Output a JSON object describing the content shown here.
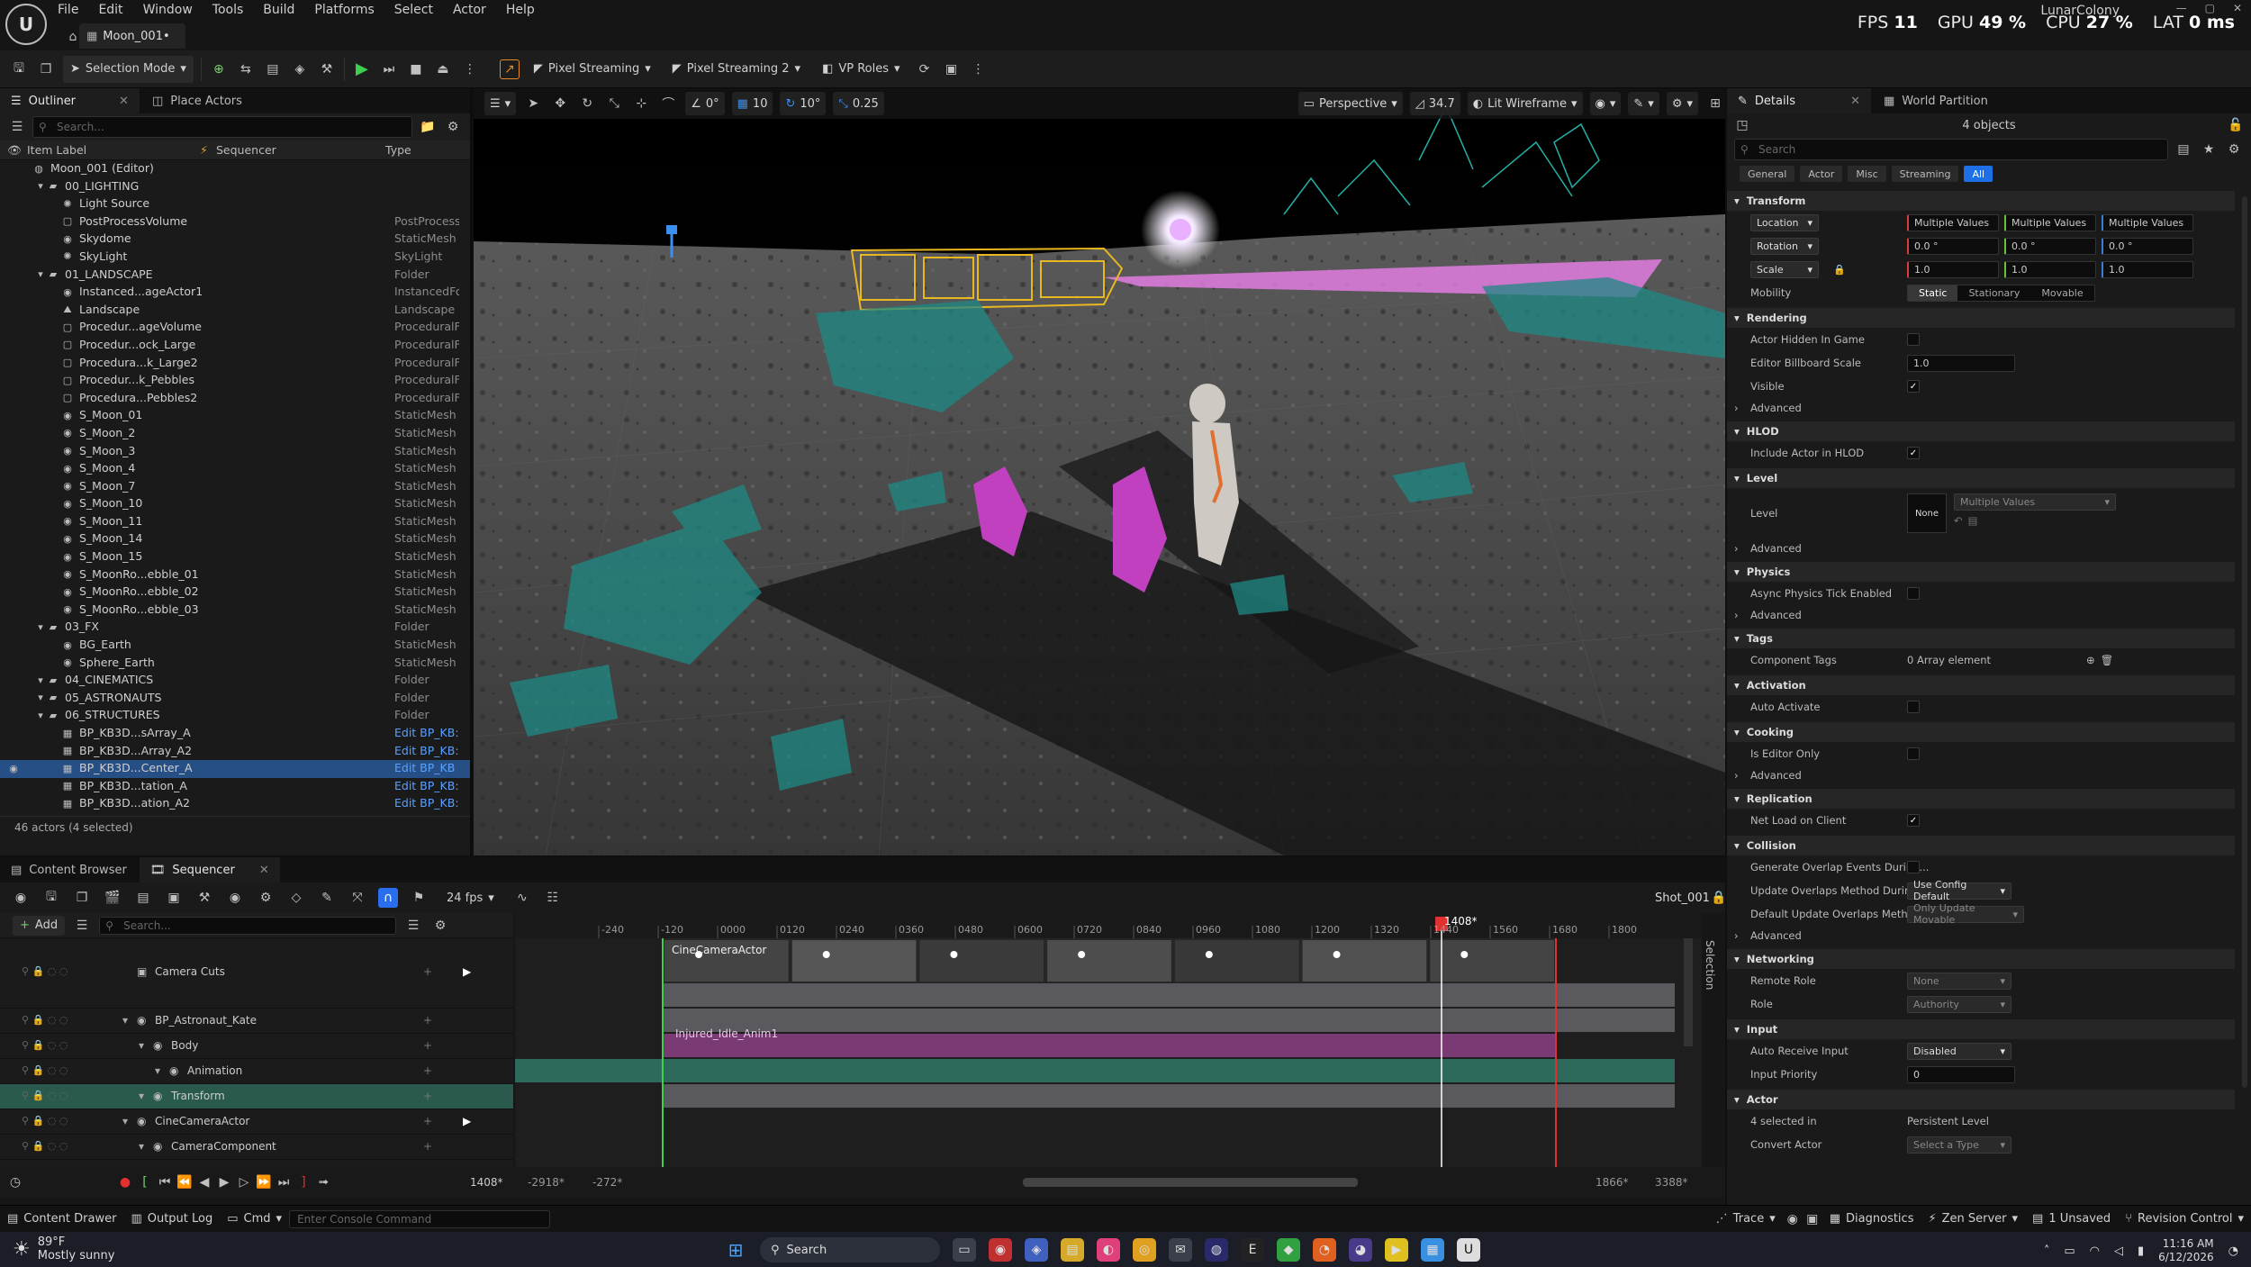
{
  "window": {
    "menu": [
      "File",
      "Edit",
      "Window",
      "Tools",
      "Build",
      "Platforms",
      "Select",
      "Actor",
      "Help"
    ],
    "map_tab": "Moon_001•",
    "project": "LunarColony",
    "stats": {
      "fps_label": "FPS",
      "fps": "11",
      "gpu_label": "GPU",
      "gpu": "49 %",
      "cpu_label": "CPU",
      "cpu": "27 %",
      "lat_label": "LAT",
      "lat": "0 ms"
    }
  },
  "toolbar": {
    "selection_mode": "Selection Mode",
    "pixel_streaming": "Pixel Streaming",
    "pixel_streaming2": "Pixel Streaming 2",
    "vp_roles": "VP Roles"
  },
  "outliner": {
    "tab": "Outliner",
    "tab2": "Place Actors",
    "search_placeholder": "Search...",
    "col_label": "Item Label",
    "col_seq": "Sequencer",
    "col_type": "Type",
    "rows": [
      {
        "label": "Moon_001 (Editor)",
        "type": "",
        "indent": 1,
        "icon": "world"
      },
      {
        "label": "00_LIGHTING",
        "type": "",
        "indent": 2,
        "icon": "folder"
      },
      {
        "label": "Light Source",
        "type": "",
        "indent": 3,
        "icon": "light"
      },
      {
        "label": "PostProcessVolume",
        "type": "PostProcess",
        "indent": 3,
        "icon": "box"
      },
      {
        "label": "Skydome",
        "type": "StaticMesh",
        "indent": 3,
        "icon": "mesh"
      },
      {
        "label": "SkyLight",
        "type": "SkyLight",
        "indent": 3,
        "icon": "light"
      },
      {
        "label": "01_LANDSCAPE",
        "type": "Folder",
        "indent": 2,
        "icon": "folder"
      },
      {
        "label": "Instanced...ageActor1",
        "type": "InstancedFo",
        "indent": 3,
        "icon": "mesh"
      },
      {
        "label": "Landscape",
        "type": "Landscape",
        "indent": 3,
        "icon": "land"
      },
      {
        "label": "Procedur...ageVolume",
        "type": "ProceduralF",
        "indent": 3,
        "icon": "box"
      },
      {
        "label": "Procedur...ock_Large",
        "type": "ProceduralF",
        "indent": 3,
        "icon": "box"
      },
      {
        "label": "Procedura...k_Large2",
        "type": "ProceduralF",
        "indent": 3,
        "icon": "box"
      },
      {
        "label": "Procedur...k_Pebbles",
        "type": "ProceduralF",
        "indent": 3,
        "icon": "box"
      },
      {
        "label": "Procedura...Pebbles2",
        "type": "ProceduralF",
        "indent": 3,
        "icon": "box"
      },
      {
        "label": "S_Moon_01",
        "type": "StaticMesh",
        "indent": 3,
        "icon": "mesh"
      },
      {
        "label": "S_Moon_2",
        "type": "StaticMesh",
        "indent": 3,
        "icon": "mesh"
      },
      {
        "label": "S_Moon_3",
        "type": "StaticMesh",
        "indent": 3,
        "icon": "mesh"
      },
      {
        "label": "S_Moon_4",
        "type": "StaticMesh",
        "indent": 3,
        "icon": "mesh"
      },
      {
        "label": "S_Moon_7",
        "type": "StaticMesh",
        "indent": 3,
        "icon": "mesh"
      },
      {
        "label": "S_Moon_10",
        "type": "StaticMesh",
        "indent": 3,
        "icon": "mesh"
      },
      {
        "label": "S_Moon_11",
        "type": "StaticMesh",
        "indent": 3,
        "icon": "mesh"
      },
      {
        "label": "S_Moon_14",
        "type": "StaticMesh",
        "indent": 3,
        "icon": "mesh"
      },
      {
        "label": "S_Moon_15",
        "type": "StaticMesh",
        "indent": 3,
        "icon": "mesh"
      },
      {
        "label": "S_MoonRo...ebble_01",
        "type": "StaticMesh",
        "indent": 3,
        "icon": "mesh"
      },
      {
        "label": "S_MoonRo...ebble_02",
        "type": "StaticMesh",
        "indent": 3,
        "icon": "mesh"
      },
      {
        "label": "S_MoonRo...ebble_03",
        "type": "StaticMesh",
        "indent": 3,
        "icon": "mesh"
      },
      {
        "label": "03_FX",
        "type": "Folder",
        "indent": 2,
        "icon": "folder"
      },
      {
        "label": "BG_Earth",
        "type": "StaticMesh",
        "indent": 3,
        "icon": "mesh"
      },
      {
        "label": "Sphere_Earth",
        "type": "StaticMesh",
        "indent": 3,
        "icon": "mesh"
      },
      {
        "label": "04_CINEMATICS",
        "type": "Folder",
        "indent": 2,
        "icon": "folder"
      },
      {
        "label": "05_ASTRONAUTS",
        "type": "Folder",
        "indent": 2,
        "icon": "folder"
      },
      {
        "label": "06_STRUCTURES",
        "type": "Folder",
        "indent": 2,
        "icon": "folder"
      },
      {
        "label": "BP_KB3D...sArray_A",
        "type": "Edit BP_KB:",
        "indent": 3,
        "icon": "bp",
        "link": true
      },
      {
        "label": "BP_KB3D...Array_A2",
        "type": "Edit BP_KB:",
        "indent": 3,
        "icon": "bp",
        "link": true
      },
      {
        "label": "BP_KB3D...Center_A",
        "type": "Edit BP_KB",
        "indent": 3,
        "icon": "bp",
        "link": true,
        "sel": true
      },
      {
        "label": "BP_KB3D...tation_A",
        "type": "Edit BP_KB:",
        "indent": 3,
        "icon": "bp",
        "link": true
      },
      {
        "label": "BP_KB3D...ation_A2",
        "type": "Edit BP_KB:",
        "indent": 3,
        "icon": "bp",
        "link": true
      }
    ],
    "footer": "46 actors (4 selected)"
  },
  "viewport": {
    "perspective": "Perspective",
    "fov": "34.7",
    "view_mode": "Lit Wireframe",
    "snap_move": "10",
    "snap_rot": "10°",
    "snap_scale": "0.25",
    "cam_speed": "0°"
  },
  "details": {
    "tab": "Details",
    "tab2": "World Partition",
    "objects": "4 objects",
    "search_placeholder": "Search",
    "filters": [
      "General",
      "Actor",
      "Misc",
      "Streaming",
      "All"
    ],
    "transform": {
      "title": "Transform",
      "location": "Location",
      "rotation": "Rotation",
      "scale": "Scale",
      "multi": "Multiple Values",
      "rot_vals": [
        "0.0 °",
        "0.0 °",
        "0.0 °"
      ],
      "scale_vals": [
        "1.0",
        "1.0",
        "1.0"
      ],
      "mobility": "Mobility",
      "mob_opts": [
        "Static",
        "Stationary",
        "Movable"
      ]
    },
    "rendering": {
      "title": "Rendering",
      "hidden": "Actor Hidden In Game",
      "billboard": "Editor Billboard Scale",
      "billboard_val": "1.0",
      "visible": "Visible",
      "advanced": "Advanced"
    },
    "hlod": {
      "title": "HLOD",
      "include": "Include Actor in HLOD"
    },
    "level": {
      "title": "Level",
      "label": "Level",
      "none": "None",
      "multi": "Multiple Values",
      "advanced": "Advanced"
    },
    "physics": {
      "title": "Physics",
      "async": "Async Physics Tick Enabled",
      "advanced": "Advanced"
    },
    "tags": {
      "title": "Tags",
      "comp": "Component Tags",
      "val": "0 Array element"
    },
    "activation": {
      "title": "Activation",
      "auto": "Auto Activate"
    },
    "cooking": {
      "title": "Cooking",
      "editor_only": "Is Editor Only",
      "advanced": "Advanced"
    },
    "replication": {
      "title": "Replication",
      "net": "Net Load on Client"
    },
    "collision": {
      "title": "Collision",
      "gen": "Generate Overlap Events During...",
      "upd": "Update Overlaps Method During...",
      "upd_val": "Use Config Default",
      "def": "Default Update Overlaps Method...",
      "def_val": "Only Update Movable",
      "advanced": "Advanced"
    },
    "networking": {
      "title": "Networking",
      "remote": "Remote Role",
      "remote_val": "None",
      "role": "Role",
      "role_val": "Authority"
    },
    "input": {
      "title": "Input",
      "auto": "Auto Receive Input",
      "auto_val": "Disabled",
      "prio": "Input Priority",
      "prio_val": "0"
    },
    "actor": {
      "title": "Actor",
      "sel": "4 selected in",
      "sel_val": "Persistent Level",
      "convert": "Convert Actor",
      "convert_val": "Select a Type"
    }
  },
  "sequencer": {
    "tab1": "Content Browser",
    "tab2": "Sequencer",
    "fps": "24 fps",
    "shot": "Shot_001",
    "add": "Add",
    "search_placeholder": "Search...",
    "ruler": [
      "-240",
      "-120",
      "0000",
      "0120",
      "0240",
      "0360",
      "0480",
      "0600",
      "0720",
      "0840",
      "0960",
      "1080",
      "1200",
      "1320",
      "1440",
      "1560",
      "1680",
      "1800"
    ],
    "playhead": "1408*",
    "tracks": [
      {
        "label": "Camera Cuts",
        "indent": 0
      },
      {
        "label": "BP_Astronaut_Kate",
        "indent": 0
      },
      {
        "label": "Body",
        "indent": 1
      },
      {
        "label": "Animation",
        "indent": 2
      },
      {
        "label": "Transform",
        "indent": 1
      },
      {
        "label": "CineCameraActor",
        "indent": 0
      },
      {
        "label": "CameraComponent",
        "indent": 1
      }
    ],
    "cam_clip": "CineCameraActor",
    "anim_clip": "Injured_Idle_Anim1",
    "frame": "1408*",
    "range_start": "-2918*",
    "range_in": "-272*",
    "range_out": "1866*",
    "range_end": "3388*",
    "selection": "Selection"
  },
  "statusbar": {
    "content_drawer": "Content Drawer",
    "output_log": "Output Log",
    "cmd": "Cmd",
    "console_placeholder": "Enter Console Command",
    "trace": "Trace",
    "diagnostics": "Diagnostics",
    "zen": "Zen Server",
    "unsaved": "1 Unsaved",
    "revision": "Revision Control"
  },
  "taskbar": {
    "weather_temp": "89°F",
    "weather_desc": "Mostly sunny",
    "search": "Search",
    "time": "11:16 AM",
    "date": "6/12/2026"
  }
}
